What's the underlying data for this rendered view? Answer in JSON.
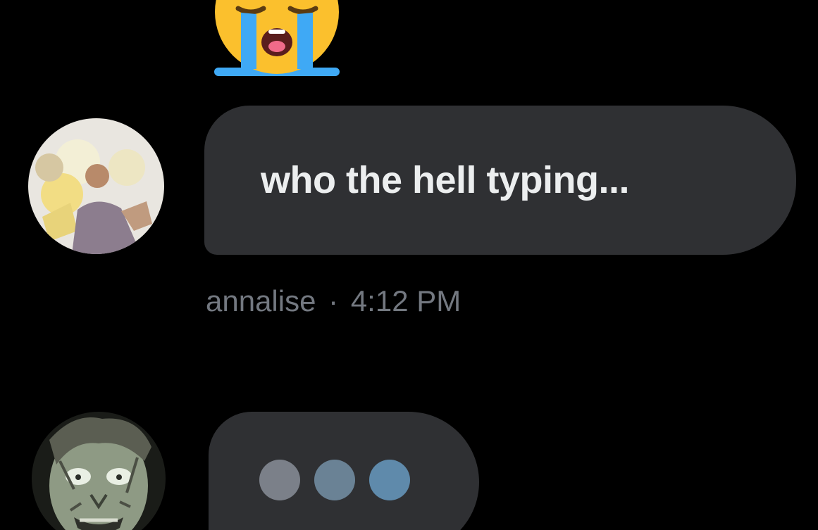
{
  "conversation": {
    "top_reaction": {
      "icon": "loudly-crying-face-emoji"
    },
    "messages": [
      {
        "avatar_icon": "profile-photo-person-with-balloons",
        "text": "who the hell typing...",
        "sender": "annalise",
        "separator": "·",
        "time": "4:12 PM"
      }
    ],
    "typing_indicator": {
      "avatar_icon": "profile-photo-exorcist-face",
      "dot_icon": "typing-dot-icon",
      "dot_count": 3
    }
  },
  "colors": {
    "background": "#000000",
    "bubble": "#2f3033",
    "message_text": "#eceeef",
    "meta_text": "#737880",
    "typing_dots": [
      "#7b8089",
      "#6a8295",
      "#5f8aab"
    ],
    "emoji_face": "#fbc02d",
    "emoji_tears": "#3fa9f5"
  }
}
